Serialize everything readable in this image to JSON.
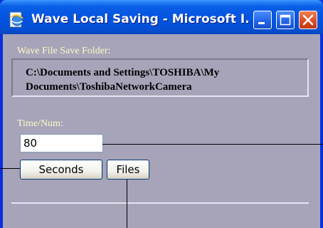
{
  "window": {
    "title": "Wave Local Saving - Microsoft I...",
    "icon": "ie-page-icon",
    "controls": [
      "minimize-icon",
      "maximize-icon",
      "close-icon"
    ]
  },
  "form": {
    "folder_label": "Wave File Save Folder:",
    "folder_path": "C:\\Documents and Settings\\TOSHIBA\\My Documents\\ToshibaNetworkCamera",
    "time_label": "Time/Num:",
    "time_value": "80",
    "seconds_button": "Seconds",
    "files_button": "Files"
  },
  "colors": {
    "titlebar": "#0454e0",
    "background": "#a7a3b9",
    "label": "#fffbc0",
    "close_button": "#d84a22"
  }
}
